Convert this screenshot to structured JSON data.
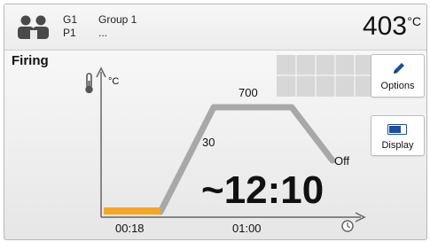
{
  "header": {
    "group_code": "G1",
    "program_code": "P1",
    "group_name": "Group 1",
    "program_name": "...",
    "temperature": "403",
    "temperature_unit": "°C",
    "users_icon": "users-icon"
  },
  "screen": {
    "mode_title": "Firing",
    "unit_label": "°C",
    "thermometer_icon": "thermometer-icon",
    "clock_icon": "clock-icon"
  },
  "curve": {
    "hold_temp_label": "700",
    "rate_label": "30",
    "cool_label": "Off",
    "start_time_label": "00:18",
    "hold_time_label": "01:00",
    "remaining_time": "~12:10",
    "progress_color": "#f6a623",
    "curve_color": "#a8a8a8"
  },
  "buttons": {
    "options_label": "Options",
    "options_icon": "pencil-icon",
    "display_label": "Display",
    "display_icon": "toggle-icon"
  },
  "colors": {
    "accent_blue": "#1f4e9c",
    "text": "#111111"
  }
}
